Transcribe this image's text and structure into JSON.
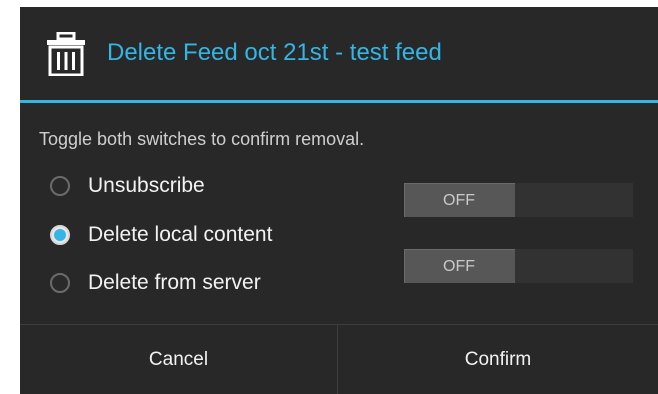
{
  "dialog": {
    "title": "Delete Feed oct 21st - test feed",
    "title_icon": "trash-icon",
    "message": "Toggle both switches to confirm removal."
  },
  "options": [
    {
      "label": "Unsubscribe",
      "checked": false
    },
    {
      "label": "Delete local content",
      "checked": true
    },
    {
      "label": "Delete from server",
      "checked": false
    }
  ],
  "switches": [
    {
      "label": "OFF"
    },
    {
      "label": "OFF"
    }
  ],
  "buttons": {
    "cancel": "Cancel",
    "confirm": "Confirm"
  },
  "colors": {
    "accent": "#33b5e5",
    "dialog_background": "#282828"
  }
}
